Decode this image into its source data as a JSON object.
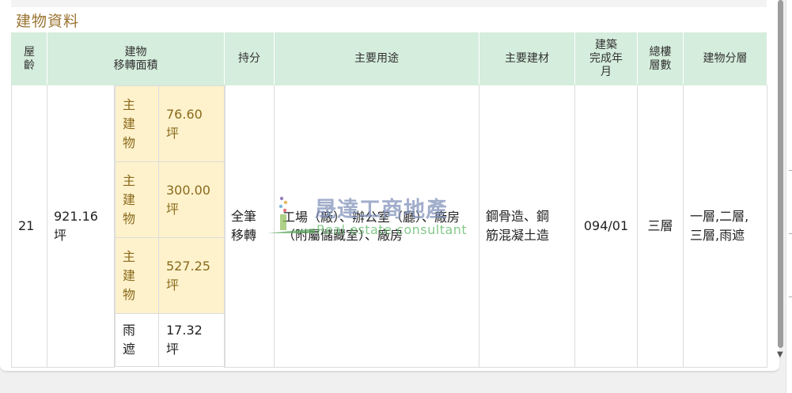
{
  "section": {
    "title": "建物資料"
  },
  "headers": {
    "age": "屋\n齡",
    "area": "建物\n移轉面積",
    "share": "持分",
    "usage": "主要用途",
    "material": "主要建材",
    "completed": "建築\n完成年\n月",
    "floors_total": "總樓\n層數",
    "floor_split": "建物分層"
  },
  "row": {
    "age": "21",
    "total_area": "921.16\n坪",
    "share": "全筆\n移轉",
    "usage": "工場（廠）、辦公室（廳）、廠房（附屬儲藏室）、廠房",
    "material": "鋼骨造、鋼\n筋混凝土造",
    "completed": "094/01",
    "floors_total": "三層",
    "floor_split": "一層,二層,\n三層,雨遮",
    "parts": [
      {
        "type": "主\n建\n物",
        "area": "76.60\n坪"
      },
      {
        "type": "主\n建\n物",
        "area": "300.00\n坪"
      },
      {
        "type": "主\n建\n物",
        "area": "527.25\n坪"
      },
      {
        "type": "雨\n遮",
        "area": "17.32\n坪"
      }
    ]
  },
  "watermark": {
    "cn": "晟達工商地產",
    "en": "Real estate consultant"
  },
  "colors": {
    "header_bg": "#d5eddc",
    "highlight_bg": "#fdf2cc",
    "title": "#9a7330"
  }
}
